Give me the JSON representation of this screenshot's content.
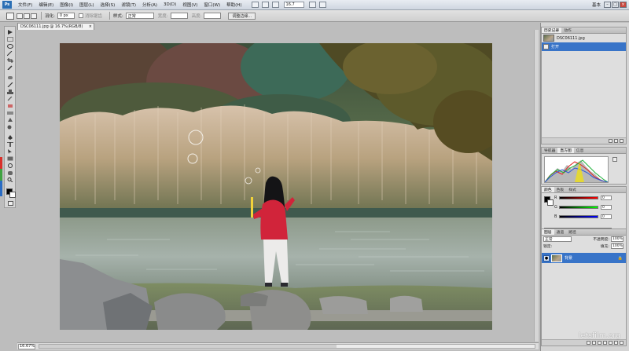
{
  "menubar": {
    "logo": "Ps",
    "items": [
      "文件(F)",
      "编辑(E)",
      "图像(I)",
      "图层(L)",
      "选择(S)",
      "滤镜(T)",
      "分析(A)",
      "3D(D)",
      "视图(V)",
      "窗口(W)",
      "帮助(H)"
    ],
    "zoom_value": "16.7",
    "workspace": "基本",
    "minimize": "–",
    "restore": "□",
    "close": "×"
  },
  "options": {
    "feather_label": "羽化:",
    "feather_value": "0 px",
    "antialias_label": "消除锯齿",
    "style_label": "样式:",
    "style_value": "正常",
    "width_label": "宽度:",
    "height_label": "高度:",
    "refine_edge": "调整边缘..."
  },
  "document": {
    "tab_title": "DSC06111.jpg @ 16.7%(RGB/8)",
    "tab_close": "×",
    "zoom_readout": "16.67%"
  },
  "history_panel": {
    "tabs": [
      "历史记录",
      "动作"
    ],
    "snapshot_name": "DSC06111.jpg",
    "state_name": "打开"
  },
  "histogram_panel": {
    "tabs": [
      "导航器",
      "直方图",
      "信息"
    ]
  },
  "color_panel": {
    "tabs": [
      "颜色",
      "色板",
      "样式"
    ],
    "rows": [
      {
        "label": "R",
        "value": "0"
      },
      {
        "label": "G",
        "value": "0"
      },
      {
        "label": "B",
        "value": "0"
      }
    ]
  },
  "layers_panel": {
    "tabs": [
      "图层",
      "通道",
      "路径"
    ],
    "blend_mode": "正常",
    "opacity_label": "不透明度:",
    "opacity_value": "100%",
    "lock_label": "锁定:",
    "fill_label": "填充:",
    "fill_value": "100%",
    "layer_name": "背景",
    "lock_glyph": "🔒"
  },
  "watermark": "letsfilm.org",
  "colors": {
    "selection_blue": "#3874c8",
    "panel_bg": "#dedede",
    "canvas_bg": "#bdbdbd"
  }
}
